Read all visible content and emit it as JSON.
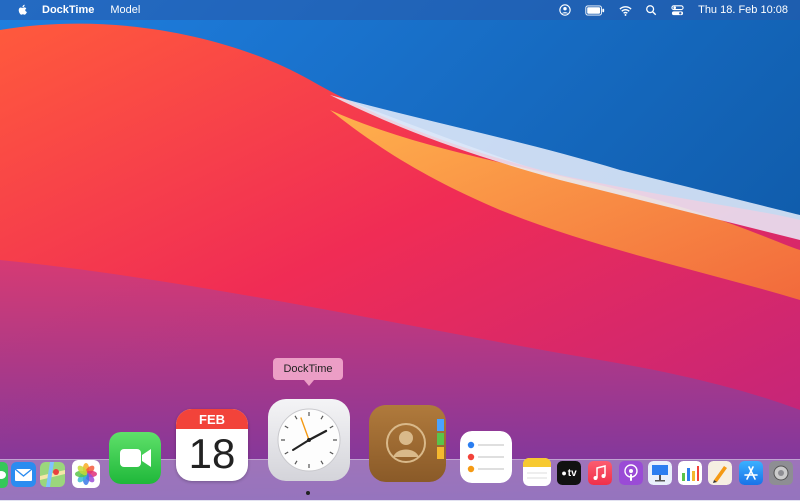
{
  "menubar": {
    "app_name": "DockTime",
    "menu_model": "Model",
    "datetime": "Thu 18. Feb  10:08",
    "icons": [
      "apple-icon",
      "user-icon",
      "battery-icon",
      "wifi-icon",
      "search-icon",
      "control-center-icon"
    ]
  },
  "tooltip": {
    "label": "DockTime"
  },
  "calendar": {
    "month": "FEB",
    "day": "18"
  },
  "clock": {
    "time": "10:08"
  },
  "apple_tv": {
    "label": "tv"
  },
  "dock_icons": [
    "messages-icon",
    "mail-icon",
    "maps-icon",
    "photos-icon",
    "facetime-icon",
    "calendar-icon",
    "docktime-clock-icon",
    "contacts-icon",
    "reminders-icon",
    "notes-icon",
    "apple-tv-icon",
    "music-icon",
    "podcasts-icon",
    "keynote-icon",
    "numbers-icon",
    "pages-icon",
    "app-store-icon",
    "system-preferences-icon"
  ],
  "colors": {
    "menubar": "#2f5fa8",
    "tooltip": "#ec9ec6",
    "dock": "#c3c3e1"
  }
}
